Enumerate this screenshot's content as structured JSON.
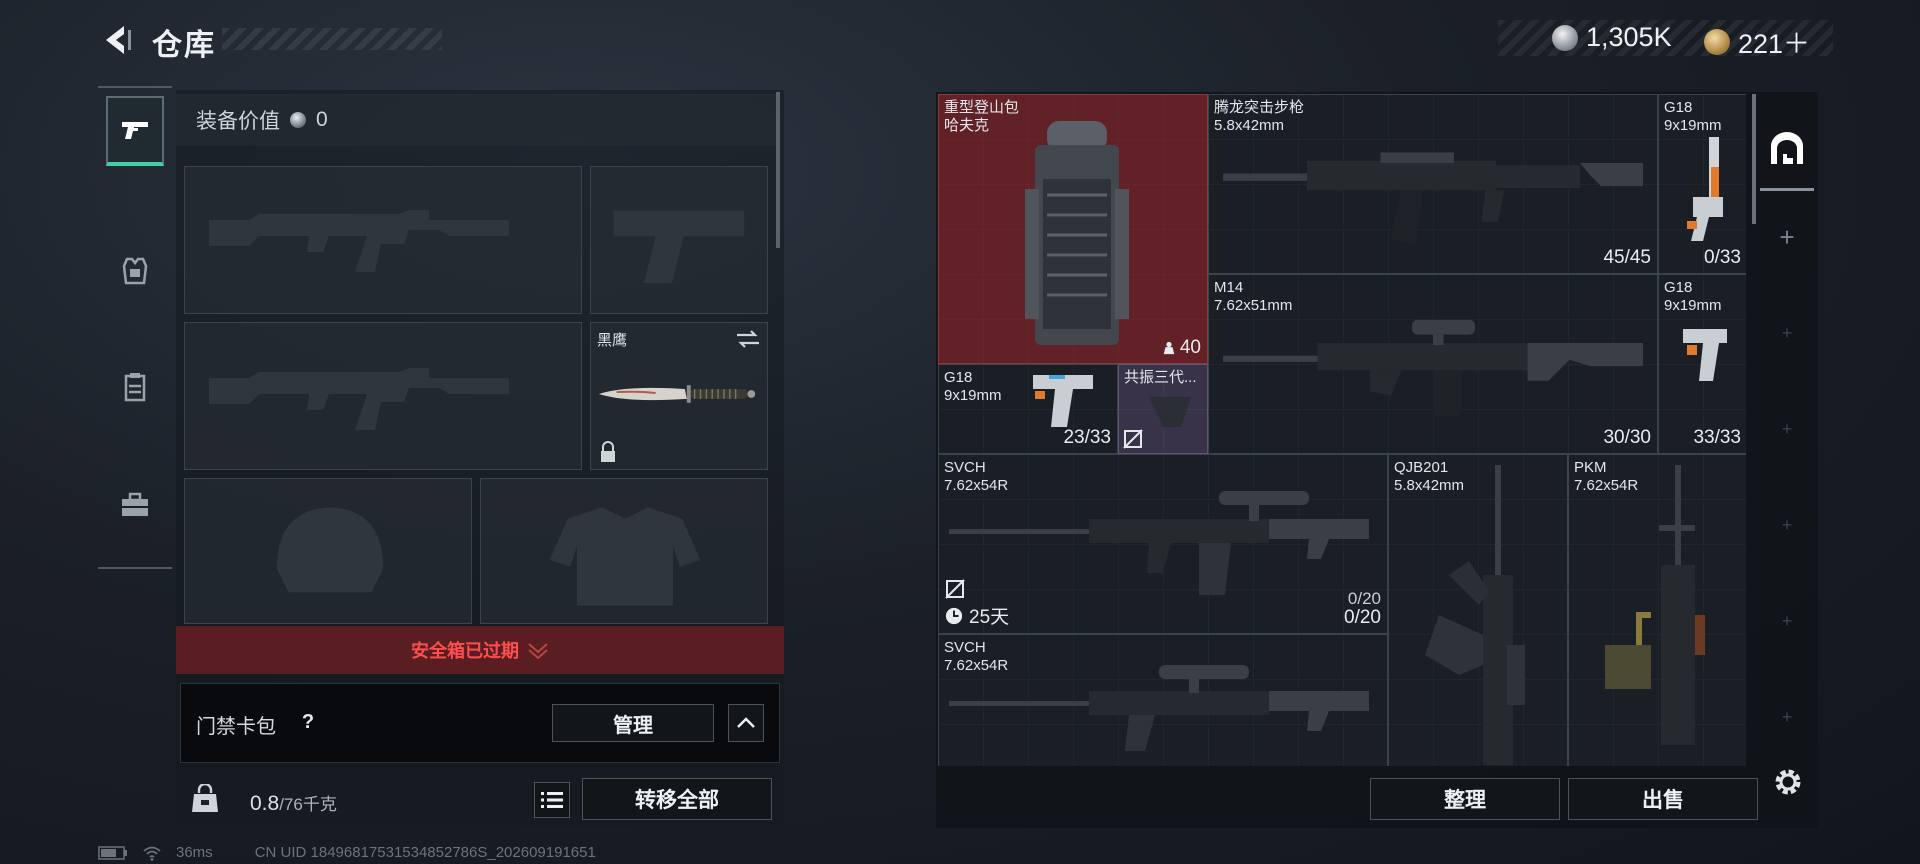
{
  "header": {
    "title": "仓库",
    "currencies": [
      {
        "icon": "silver-coin-icon",
        "value": "1,305K"
      },
      {
        "icon": "gold-coin-icon",
        "value": "221＋"
      }
    ]
  },
  "nav": {
    "items": [
      {
        "icon": "pistol-icon",
        "active": true
      },
      {
        "icon": "armor-vest-icon",
        "active": false
      },
      {
        "icon": "chest-rig-icon",
        "active": false
      },
      {
        "icon": "toolbox-icon",
        "active": false
      }
    ]
  },
  "loadout": {
    "value_label": "装备价值",
    "value": "0",
    "melee_name": "黑鹰",
    "safebox_text": "安全箱已过期",
    "cardpack_label": "门禁卡包",
    "help": "?",
    "manage_label": "管理",
    "weight_value": "0.8",
    "weight_capacity": "/76千克",
    "transfer_label": "转移全部"
  },
  "storage": {
    "items": [
      {
        "name": "重型登山包\n哈夫克",
        "count": "40"
      },
      {
        "name": "腾龙突击步枪\n5.8x42mm",
        "count": "45/45"
      },
      {
        "name": "G18\n9x19mm",
        "count": "0/33"
      },
      {
        "name": "M14\n7.62x51mm",
        "count": "30/30"
      },
      {
        "name": "G18\n9x19mm",
        "count": "33/33"
      },
      {
        "name": "G18\n9x19mm",
        "count": "23/33"
      },
      {
        "name": "共振三代..."
      },
      {
        "name": "SVCH\n7.62x54R",
        "capacity": "0/20",
        "count": "0/20",
        "timer": "25天"
      },
      {
        "name": "QJB201\n5.8x42mm"
      },
      {
        "name": "PKM\n7.62x54R"
      },
      {
        "name": "SVCH\n7.62x54R"
      }
    ],
    "sort_label": "整理",
    "sell_label": "出售",
    "tabs_plus": "+"
  },
  "status": {
    "ping": "36ms",
    "uid": "CN UID 18496817531534852786S_202609191651"
  }
}
